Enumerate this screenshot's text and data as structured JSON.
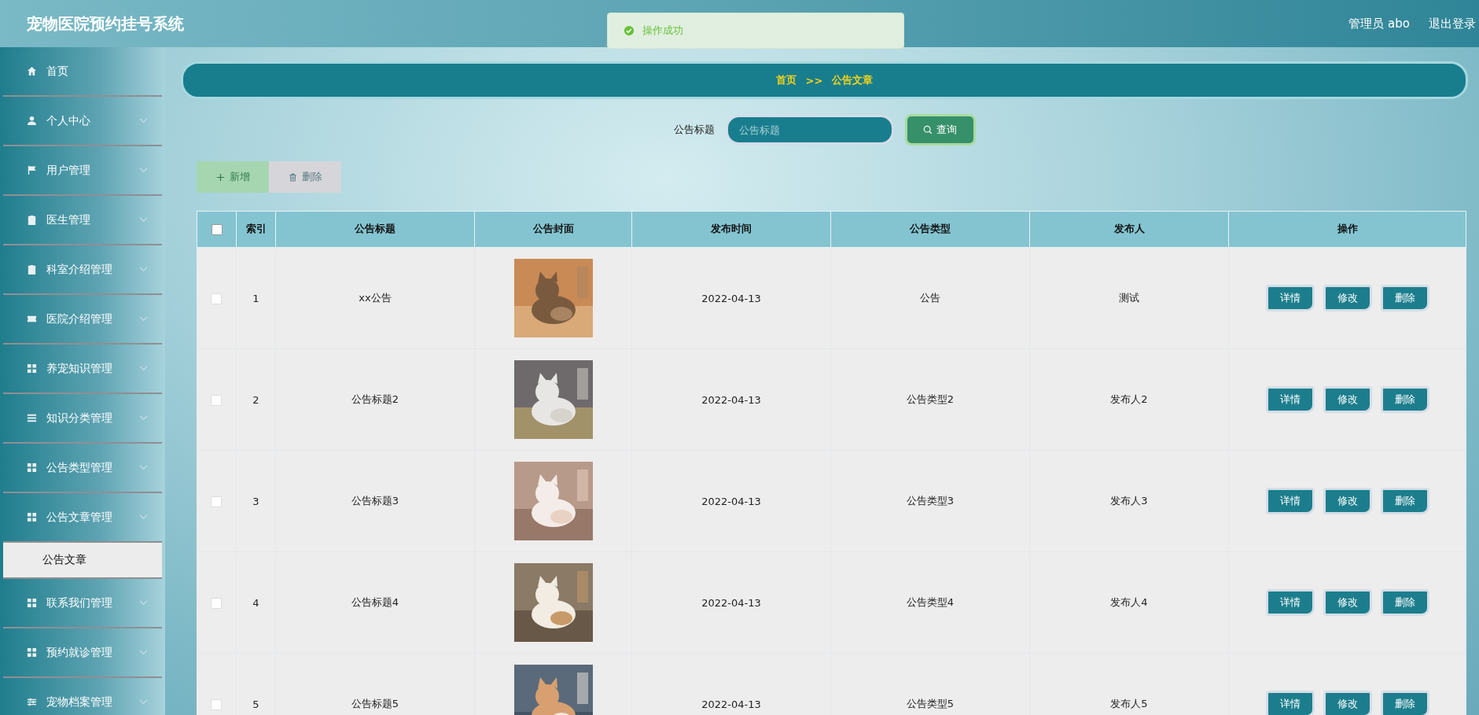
{
  "header": {
    "title": "宠物医院预约挂号系统",
    "user": "管理员 abo",
    "logout": "退出登录"
  },
  "toast": {
    "message": "操作成功"
  },
  "sidebar": {
    "items": [
      {
        "kind": "link",
        "label": "首页"
      },
      {
        "kind": "menu",
        "label": "个人中心"
      },
      {
        "kind": "menu",
        "label": "用户管理"
      },
      {
        "kind": "menu",
        "label": "医生管理"
      },
      {
        "kind": "menu",
        "label": "科室介绍管理"
      },
      {
        "kind": "menu",
        "label": "医院介绍管理"
      },
      {
        "kind": "menu",
        "label": "养宠知识管理"
      },
      {
        "kind": "menu",
        "label": "知识分类管理"
      },
      {
        "kind": "menu",
        "label": "公告类型管理"
      },
      {
        "kind": "menu",
        "label": "公告文章管理",
        "children": [
          {
            "label": "公告文章",
            "selected": true
          }
        ]
      },
      {
        "kind": "menu",
        "label": "联系我们管理"
      },
      {
        "kind": "menu",
        "label": "预约就诊管理"
      },
      {
        "kind": "menu",
        "label": "宠物档案管理"
      }
    ]
  },
  "breadcrumb": {
    "home": "首页",
    "separator": ">>",
    "current": "公告文章"
  },
  "search": {
    "label": "公告标题",
    "placeholder": "公告标题",
    "button": "查询"
  },
  "toolbar": [
    {
      "kind": "add",
      "label": "新增",
      "disabled": true
    },
    {
      "kind": "delete",
      "label": "删除",
      "disabled": true
    }
  ],
  "table": {
    "columns": [
      "索引",
      "公告标题",
      "公告封面",
      "发布时间",
      "公告类型",
      "发布人",
      "操作"
    ],
    "header_checked": false,
    "rows": [
      {
        "checked": false,
        "index": "1",
        "title": "xx公告",
        "date": "2022-04-13",
        "type": "公告",
        "publisher": "测试",
        "actions": [
          "详情",
          "修改",
          "删除"
        ]
      },
      {
        "checked": false,
        "index": "2",
        "title": "公告标题2",
        "date": "2022-04-13",
        "type": "公告类型2",
        "publisher": "发布人2",
        "actions": [
          "详情",
          "修改",
          "删除"
        ]
      },
      {
        "checked": false,
        "index": "3",
        "title": "公告标题3",
        "date": "2022-04-13",
        "type": "公告类型3",
        "publisher": "发布人3",
        "actions": [
          "详情",
          "修改",
          "删除"
        ]
      },
      {
        "checked": false,
        "index": "4",
        "title": "公告标题4",
        "date": "2022-04-13",
        "type": "公告类型4",
        "publisher": "发布人4",
        "actions": [
          "详情",
          "修改",
          "删除"
        ]
      },
      {
        "checked": false,
        "index": "5",
        "title": "公告标题5",
        "date": "2022-04-13",
        "type": "公告类型5",
        "publisher": "发布人5",
        "actions": [
          "详情",
          "修改",
          "删除"
        ]
      }
    ]
  }
}
